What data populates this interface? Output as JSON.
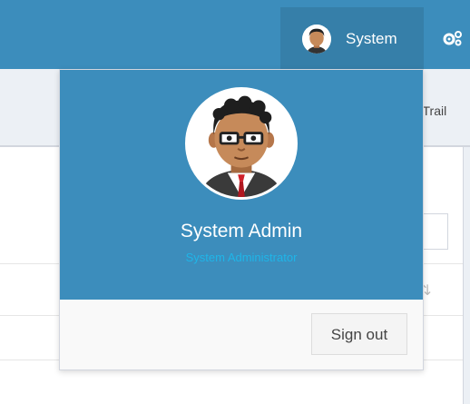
{
  "header": {
    "user_name": "System",
    "avatar_icon": "user-avatar-icon",
    "settings_icon": "gears-icon",
    "accent_color": "#3c8dbc"
  },
  "subheader": {
    "breadcrumb_fragment": "t Trail"
  },
  "user_dropdown": {
    "full_name": "System Admin",
    "role": "System Administrator",
    "signout_label": "Sign out"
  }
}
